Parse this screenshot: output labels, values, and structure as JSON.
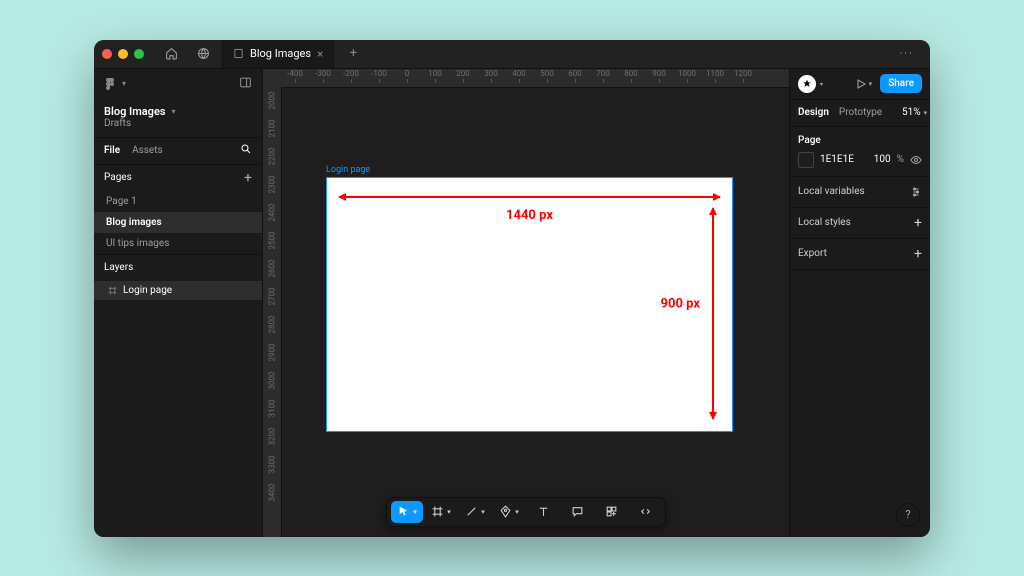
{
  "titlebar": {
    "tab_label": "Blog Images",
    "more_label": "···"
  },
  "project": {
    "name": "Blog Images",
    "location": "Drafts"
  },
  "left_tabs": {
    "file": "File",
    "assets": "Assets"
  },
  "pages": {
    "heading": "Pages",
    "items": [
      "Page 1",
      "Blog images",
      "UI tips images"
    ],
    "active_index": 1
  },
  "layers": {
    "heading": "Layers",
    "items": [
      "Login page"
    ]
  },
  "ruler": {
    "top": [
      -400,
      -300,
      -200,
      -100,
      0,
      100,
      200,
      300,
      400,
      500,
      600,
      700,
      800,
      900,
      1000,
      1100,
      1200
    ],
    "left": [
      2000,
      2100,
      2200,
      2300,
      2400,
      2500,
      2600,
      2700,
      2800,
      2900,
      3000,
      3100,
      3200,
      3300,
      3400
    ]
  },
  "canvas": {
    "frame_label": "Login page",
    "width_label": "1440 px",
    "height_label": "900 px"
  },
  "toolbar": {
    "tools": [
      {
        "id": "move",
        "icon": "cursor",
        "active": true,
        "dropdown": true
      },
      {
        "id": "frame",
        "icon": "frame",
        "dropdown": true
      },
      {
        "id": "line",
        "icon": "line",
        "dropdown": true
      },
      {
        "id": "pen",
        "icon": "pen",
        "dropdown": true
      },
      {
        "id": "text",
        "icon": "text"
      },
      {
        "id": "comment",
        "icon": "comment"
      },
      {
        "id": "widget",
        "icon": "widget"
      },
      {
        "id": "devmode",
        "icon": "dev"
      }
    ]
  },
  "right": {
    "share_label": "Share",
    "tabs": {
      "design": "Design",
      "prototype": "Prototype"
    },
    "zoom": "51%",
    "page_section": {
      "heading": "Page",
      "color_hex": "1E1E1E",
      "opacity": "100",
      "opacity_unit": "%"
    },
    "rows": {
      "local_variables": "Local variables",
      "local_styles": "Local styles",
      "export": "Export"
    }
  },
  "help_label": "?"
}
